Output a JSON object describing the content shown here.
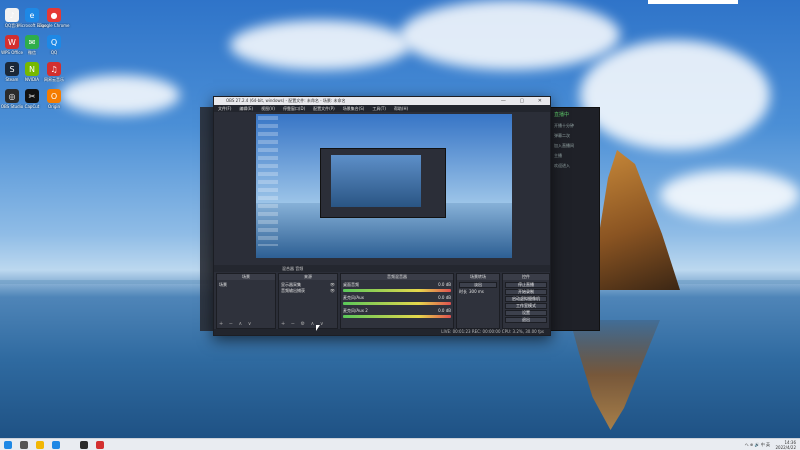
{
  "desktop": {
    "icons": [
      {
        "label": "QQ音乐",
        "color": "#f2f2f2",
        "glyph": "♪"
      },
      {
        "label": "Microsoft Edge",
        "color": "#1e88e5",
        "glyph": "e"
      },
      {
        "label": "Google Chrome",
        "color": "#e53935",
        "glyph": "●"
      },
      {
        "label": "WPS Office",
        "color": "#d32f2f",
        "glyph": "W"
      },
      {
        "label": "微信",
        "color": "#2eae4a",
        "glyph": "✉"
      },
      {
        "label": "QQ",
        "color": "#1e88e5",
        "glyph": "Q"
      },
      {
        "label": "Steam",
        "color": "#1b2838",
        "glyph": "S"
      },
      {
        "label": "NVIDIA",
        "color": "#76b900",
        "glyph": "N"
      },
      {
        "label": "网易云音乐",
        "color": "#d32f2f",
        "glyph": "♫"
      },
      {
        "label": "OBS Studio",
        "color": "#2b2b2b",
        "glyph": "◎"
      },
      {
        "label": "CapCut",
        "color": "#111111",
        "glyph": "✂"
      },
      {
        "label": "Origin",
        "color": "#f57c00",
        "glyph": "O"
      }
    ]
  },
  "obs": {
    "title": "OBS 27.2.4 (64-bit, windows) - 配置文件: 未命名 - 场景: 未命名",
    "menu": [
      "文件(F)",
      "编辑(E)",
      "视图(V)",
      "停靠窗口(D)",
      "配置文件(P)",
      "场景集合(S)",
      "工具(T)",
      "帮助(H)"
    ],
    "tabs": "混合器 音频",
    "docks": {
      "scenes": {
        "title": "场景",
        "items": [
          "场景"
        ]
      },
      "sources": {
        "title": "来源",
        "items": [
          "显示器采集",
          "音频输出捕获"
        ]
      },
      "mixer": {
        "title": "音频混音器",
        "channels": [
          {
            "name": "桌面音频",
            "level": "0.0 dB"
          },
          {
            "name": "麦克风/Aux",
            "level": "0.0 dB"
          },
          {
            "name": "麦克风/Aux 2",
            "level": "0.0 dB"
          }
        ]
      },
      "transitions": {
        "title": "场景转场",
        "type": "淡出",
        "duration_label": "时长",
        "duration": "300 ms"
      },
      "controls": {
        "title": "控件",
        "buttons": [
          "停止直播",
          "开始录制",
          "启动虚拟摄像机",
          "工作室模式",
          "设置",
          "退出"
        ]
      }
    },
    "status": "LIVE: 00:01:23   REC: 00:00:00   CPU: 3.2%, 30.00 fps"
  },
  "side_panel": {
    "header": "直播中",
    "lines": [
      "开播十分钟",
      "弹幕二次",
      "加入直播间",
      "主播",
      "欢迎进入"
    ]
  },
  "taskbar": {
    "tray": "へ ⊕ 🔊 中 英",
    "time": "14:36",
    "date": "2022/4/22"
  }
}
